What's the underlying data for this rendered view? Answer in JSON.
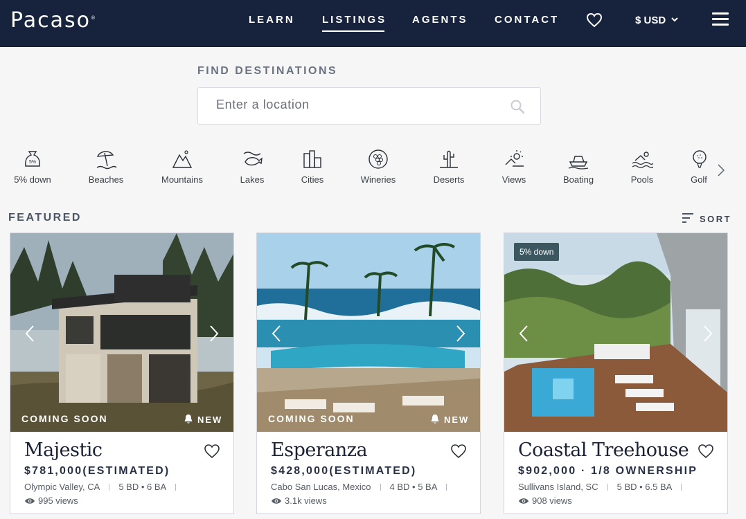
{
  "nav": {
    "logo": "Pacaso",
    "logo_mark": "®",
    "links": [
      {
        "label": "LEARN",
        "active": false
      },
      {
        "label": "LISTINGS",
        "active": true
      },
      {
        "label": "AGENTS",
        "active": false
      },
      {
        "label": "CONTACT",
        "active": false
      }
    ],
    "currency": "$ USD",
    "icons": [
      "heart-icon",
      "chevron-down-icon",
      "menu-icon"
    ]
  },
  "search": {
    "label": "FIND DESTINATIONS",
    "placeholder": "Enter a location",
    "value": ""
  },
  "categories": [
    {
      "label": "5% down",
      "icon": "money-bag-icon"
    },
    {
      "label": "Beaches",
      "icon": "beach-umbrella-icon"
    },
    {
      "label": "Mountains",
      "icon": "mountain-icon"
    },
    {
      "label": "Lakes",
      "icon": "lake-icon"
    },
    {
      "label": "Cities",
      "icon": "city-icon"
    },
    {
      "label": "Wineries",
      "icon": "grapes-icon"
    },
    {
      "label": "Deserts",
      "icon": "cactus-icon"
    },
    {
      "label": "Views",
      "icon": "sunset-icon"
    },
    {
      "label": "Boating",
      "icon": "boat-icon"
    },
    {
      "label": "Pools",
      "icon": "swimmer-icon"
    },
    {
      "label": "Golf",
      "icon": "golf-ball-icon"
    }
  ],
  "featured": {
    "label": "FEATURED",
    "sort_label": "SORT"
  },
  "listings": [
    {
      "name": "Majestic",
      "price": "$781,000",
      "price_note": "(ESTIMATED)",
      "location": "Olympic Valley, CA",
      "beds_baths": "5 BD • 6 BA",
      "views": "995 views",
      "status": "COMING SOON",
      "tag": "NEW",
      "badge": ""
    },
    {
      "name": "Esperanza",
      "price": "$428,000",
      "price_note": "(ESTIMATED)",
      "location": "Cabo San Lucas, Mexico",
      "beds_baths": "4 BD • 5 BA",
      "views": "3.1k views",
      "status": "COMING SOON",
      "tag": "NEW",
      "badge": ""
    },
    {
      "name": "Coastal Treehouse",
      "price": "$902,000",
      "price_note": " · 1/8 OWNERSHIP",
      "location": "Sullivans Island, SC",
      "beds_baths": "5 BD • 6.5 BA",
      "views": "908 views",
      "status": "",
      "tag": "",
      "badge": "5% down"
    }
  ]
}
